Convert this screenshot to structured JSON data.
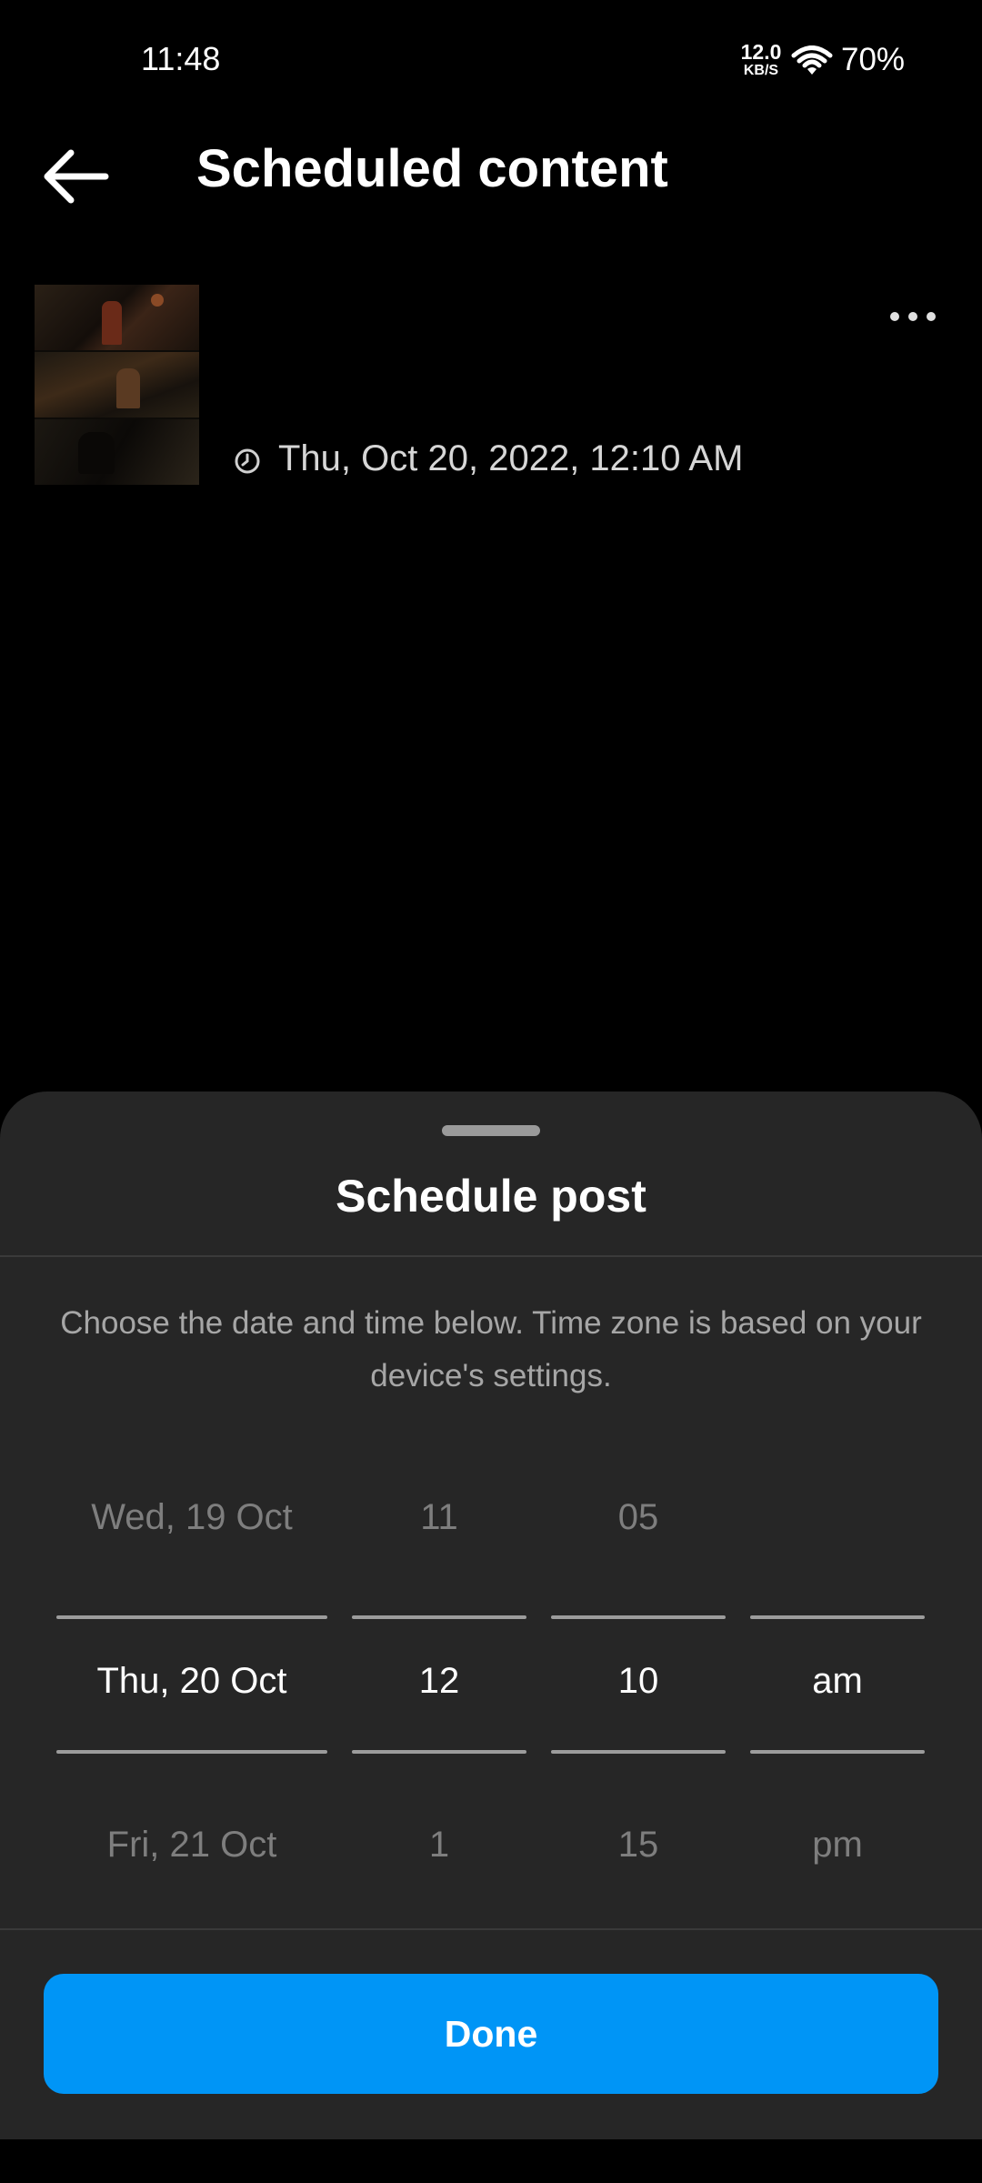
{
  "status_bar": {
    "time": "11:48",
    "net_speed_value": "12.0",
    "net_speed_unit": "KB/S",
    "battery": "70%"
  },
  "header": {
    "title": "Scheduled content",
    "back_icon": "arrow-left-icon"
  },
  "scheduled_item": {
    "datetime": "Thu, Oct 20, 2022, 12:10 AM",
    "clock_icon": "clock-icon",
    "more_icon": "more-horizontal-icon"
  },
  "sheet": {
    "title": "Schedule post",
    "description": "Choose the date and time below. Time zone is based on your device's settings.",
    "picker": {
      "date": {
        "prev": "Wed, 19 Oct",
        "selected": "Thu, 20 Oct",
        "next": "Fri, 21 Oct"
      },
      "hour": {
        "prev": "11",
        "selected": "12",
        "next": "1"
      },
      "minute": {
        "prev": "05",
        "selected": "10",
        "next": "15"
      },
      "ampm": {
        "prev": "",
        "selected": "am",
        "next": "pm"
      }
    },
    "done_label": "Done"
  },
  "colors": {
    "background": "#000000",
    "sheet_background": "#262626",
    "accent": "#0095f6"
  }
}
